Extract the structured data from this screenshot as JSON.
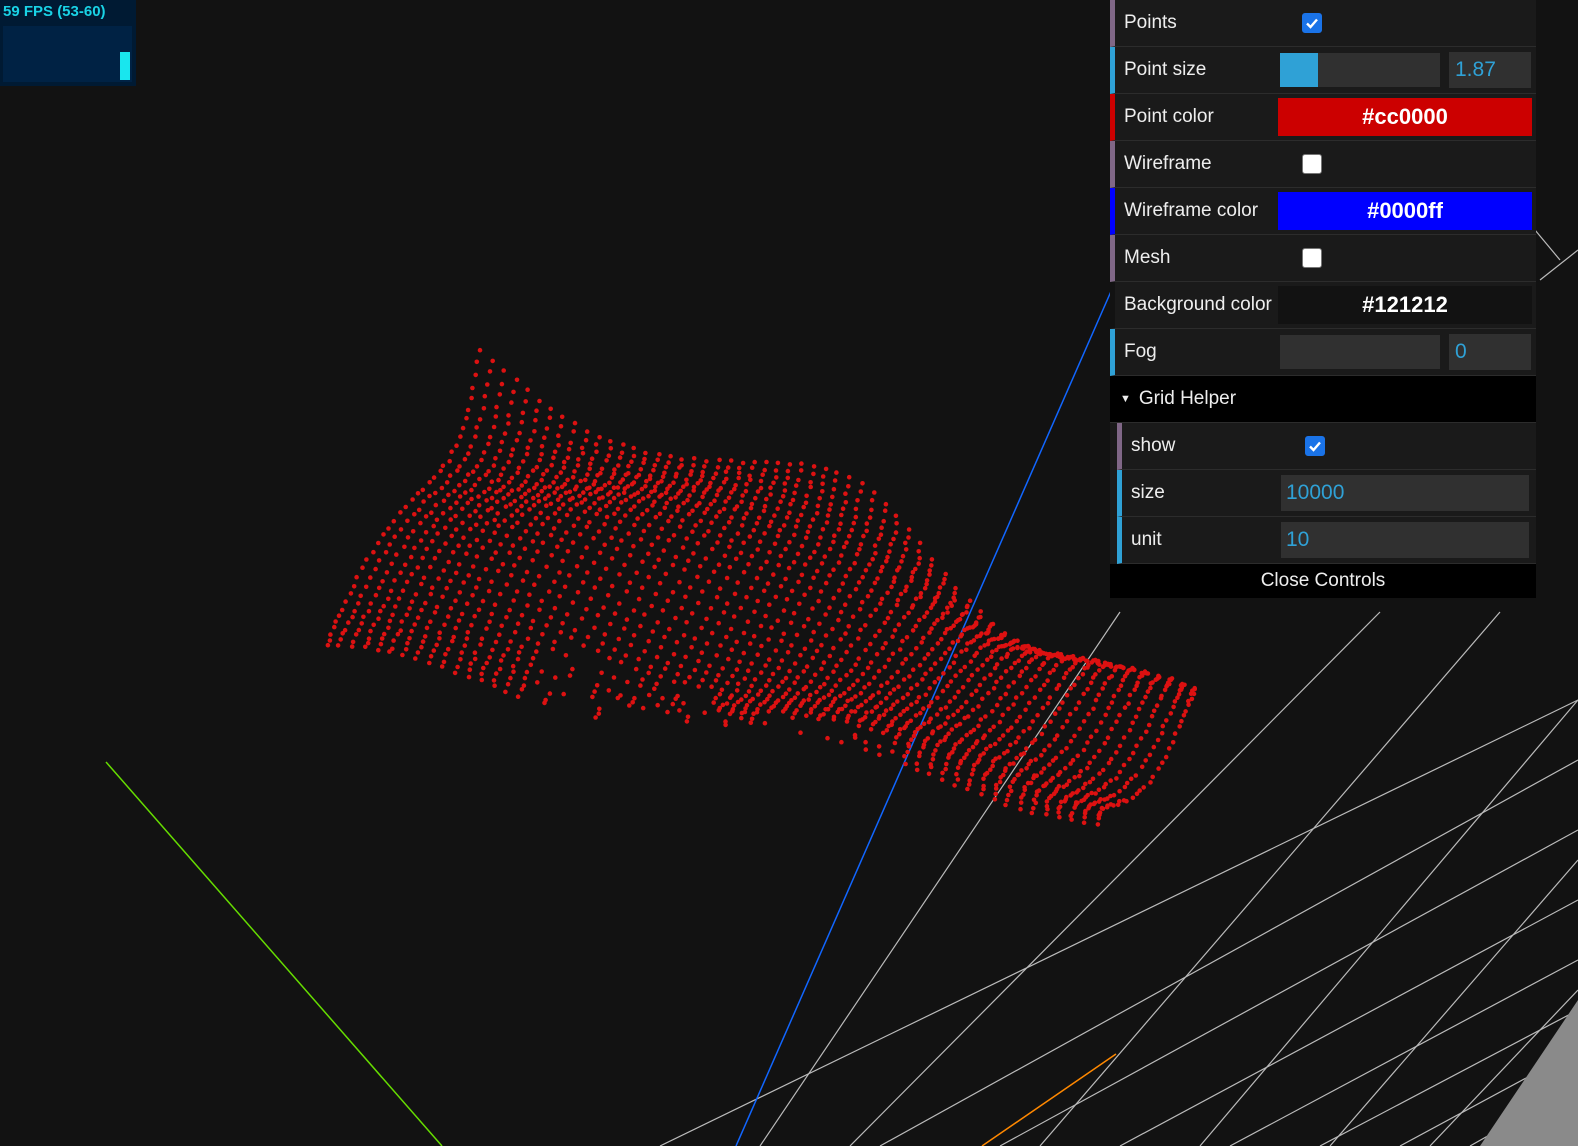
{
  "stats": {
    "fps_text": "59 FPS (53-60)",
    "fps_level": 0.5
  },
  "gui": {
    "points": {
      "label": "Points",
      "checked": true
    },
    "point_size": {
      "label": "Point size",
      "value": "1.87",
      "fill": 0.24
    },
    "point_color": {
      "label": "Point color",
      "value": "#cc0000"
    },
    "wireframe": {
      "label": "Wireframe",
      "checked": false
    },
    "wireframe_color": {
      "label": "Wireframe color",
      "value": "#0000ff"
    },
    "mesh": {
      "label": "Mesh",
      "checked": false
    },
    "background_color": {
      "label": "Background color",
      "value": "#121212"
    },
    "fog": {
      "label": "Fog",
      "value": "0",
      "fill": 0
    },
    "grid_helper": {
      "title": "Grid Helper",
      "show": {
        "label": "show",
        "checked": true
      },
      "size": {
        "label": "size",
        "value": "10000"
      },
      "unit": {
        "label": "unit",
        "value": "10"
      }
    },
    "close_label": "Close Controls"
  },
  "colors": {
    "points": "#dd1111",
    "axis_x": "#ff8800",
    "axis_y": "#66dd00",
    "axis_z": "#1166ff",
    "grid": "#bbbbbb",
    "check_accent": "#1a73e8"
  }
}
